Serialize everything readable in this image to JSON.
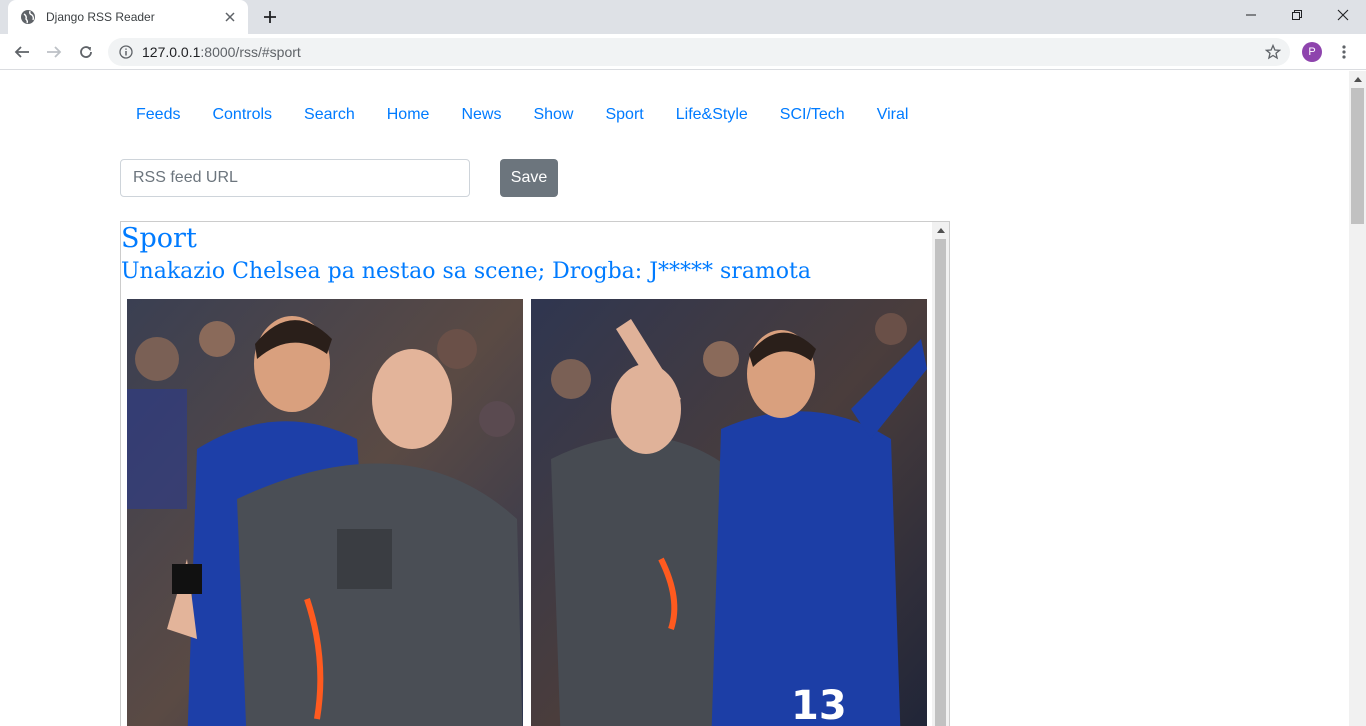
{
  "browser": {
    "tab_title": "Django RSS Reader",
    "url_host": "127.0.0.1",
    "url_rest": ":8000/rss/#sport",
    "profile_initial": "P"
  },
  "nav": {
    "items": [
      {
        "label": "Feeds"
      },
      {
        "label": "Controls"
      },
      {
        "label": "Search"
      },
      {
        "label": "Home"
      },
      {
        "label": "News"
      },
      {
        "label": "Show"
      },
      {
        "label": "Sport"
      },
      {
        "label": "Life&Style"
      },
      {
        "label": "SCI/Tech"
      },
      {
        "label": "Viral"
      }
    ]
  },
  "form": {
    "url_placeholder": "RSS feed URL",
    "url_value": "",
    "save_label": "Save"
  },
  "feed": {
    "section_title": "Sport",
    "article_title": "Unakazio Chelsea pa nestao sa scene; Drogba: J***** sramota"
  },
  "colors": {
    "link": "#007bff",
    "button": "#6c757d"
  }
}
